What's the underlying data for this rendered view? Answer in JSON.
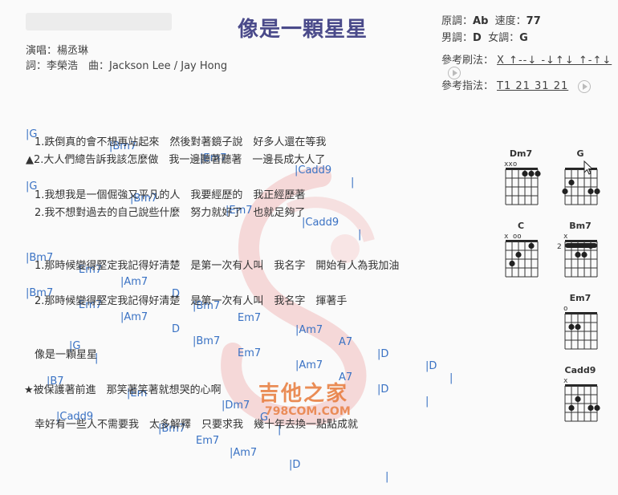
{
  "song": {
    "title": "像是一顆星星",
    "singer": "演唱：楊丞琳",
    "credits": "詞：李榮浩　曲：Jackson Lee / Jay Hong"
  },
  "info": {
    "original_key_label": "原調：",
    "original_key": "Ab",
    "tempo_label": "速度：",
    "tempo": "77",
    "male_key_label": "男調：",
    "male_key": "D",
    "female_key_label": "女調：",
    "female_key": "G",
    "strum_label": "參考刷法：",
    "strum": "X ↑--↓ -↓↑↓ ↑-↑↓",
    "pick_label": "參考指法：",
    "pick": "T1 21 31 21"
  },
  "sheet": {
    "c1": [
      "|G",
      "|Bm7",
      "|Em7",
      "|Cadd9",
      "|"
    ],
    "l1": "1.跌倒真的會不想再站起來　然後對著鏡子說　好多人還在等我",
    "l2": "▲2.大人們總告訴我該怎麼做　我一邊聽著聽著　一邊長成大人了",
    "c2": [
      "|G",
      "|Bm7",
      "|Em7",
      "|Cadd9",
      "|"
    ],
    "l3": "1.我想我是一個倔強又平凡的人　我要經歷的　我正經歷著",
    "l4": "2.我不想對過去的自己說些什麼　努力就好了　也就足夠了",
    "c3": [
      "|Bm7",
      "Em7",
      "|Am7",
      "D",
      "|Bm7",
      "Em7",
      "|Am7",
      "A7",
      "|D",
      "|D",
      "|"
    ],
    "l5": "1.那時候變得堅定我記得好清楚　是第一次有人叫　我名字　開始有人為我加油",
    "c4": [
      "|Bm7",
      "Em7",
      "|Am7",
      "D",
      "|Bm7",
      "Em7",
      "|Am7",
      "A7",
      "|D",
      "|"
    ],
    "l6": "2.那時候變得堅定我記得好清楚　是第一次有人叫　我名字　揮著手",
    "c5": [
      "|G",
      "|"
    ],
    "l7": "像是一顆星星",
    "c6": [
      "|B7",
      "|Em",
      "|Dm7",
      "G",
      "|"
    ],
    "l8": "★被保護著前進　那笑著笑著就想哭的心啊",
    "c7": [
      "|Cadd9",
      "|Bm7",
      "Em7",
      "|Am7",
      "|D",
      "|"
    ],
    "l9": "幸好有一些人不需要我　太多解釋　只要求我　幾十年去換一點點成就"
  },
  "diagrams": [
    {
      "name": "Dm7",
      "marks": "xxo"
    },
    {
      "name": "G",
      "marks": ""
    },
    {
      "name": "C",
      "marks": "x  oo"
    },
    {
      "name": "Bm7",
      "marks": "x",
      "fret": "2"
    },
    {
      "name": "Em7",
      "marks": "o"
    },
    {
      "name": "Cadd9",
      "marks": "x"
    }
  ],
  "watermark": {
    "text": "吉他之家",
    "url": "798COM.COM"
  }
}
